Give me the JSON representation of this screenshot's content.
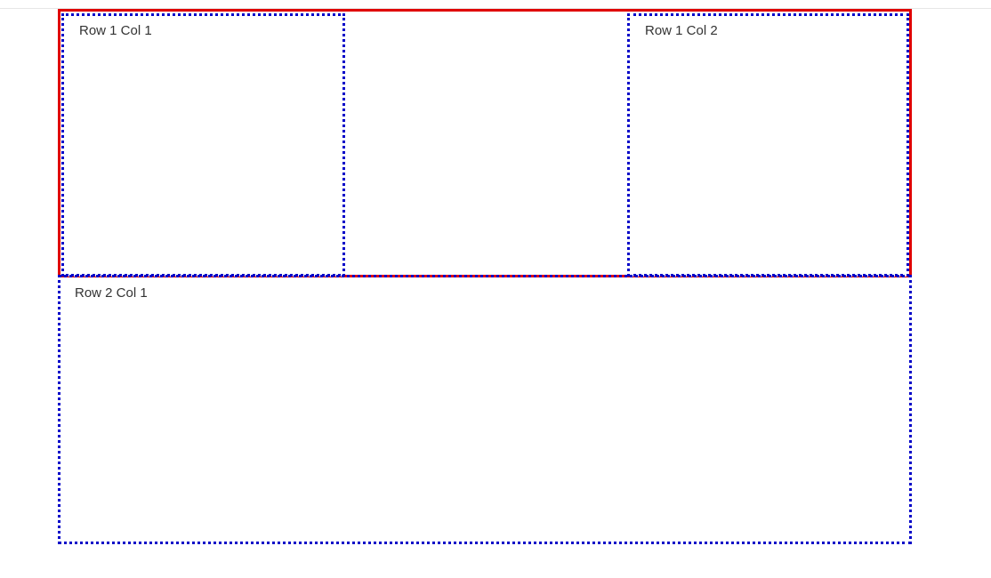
{
  "layout": {
    "row1": {
      "col1": {
        "label": "Row 1 Col 1"
      },
      "col2": {
        "label": "Row 1 Col 2"
      }
    },
    "row2": {
      "col1": {
        "label": "Row 2 Col 1"
      }
    }
  },
  "colors": {
    "row_outline": "#e00000",
    "cell_outline": "#0000c8",
    "text": "#333333"
  }
}
